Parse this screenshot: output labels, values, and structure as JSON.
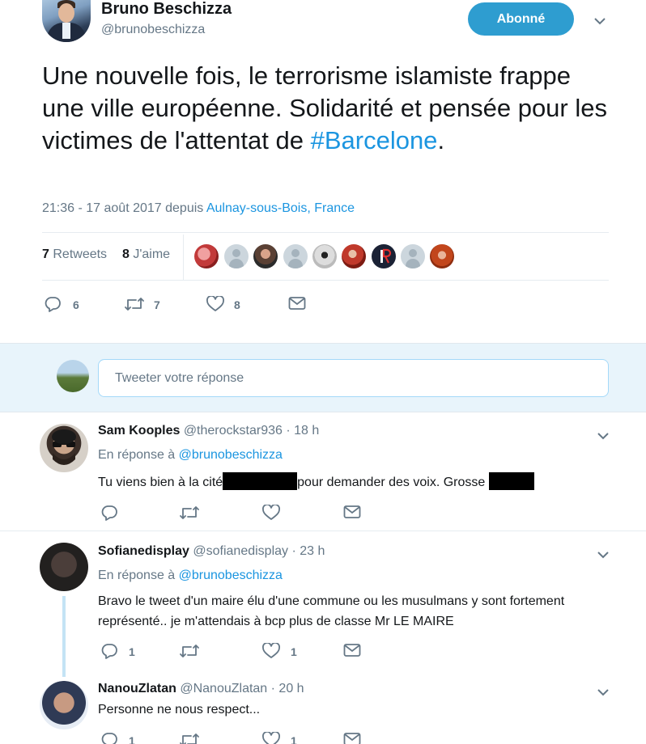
{
  "tweet": {
    "author_name": "Bruno Beschizza",
    "author_handle": "@brunobeschizza",
    "follow_label": "Abonné",
    "text_part1": "Une nouvelle fois, le terrorisme islamiste frappe une ville européenne. Solidarité et pensée pour les victimes de l'attentat de ",
    "hashtag": "#Barcelone",
    "text_part2": ".",
    "timestamp": "21:36 - 17 août 2017 depuis ",
    "location": "Aulnay-sous-Bois, France",
    "retweets_count": "7",
    "retweets_label": "Retweets",
    "likes_count": "8",
    "likes_label": "J'aime",
    "reply_count": "6",
    "retweet_count": "7",
    "like_count": "8"
  },
  "reply_box": {
    "placeholder": "Tweeter votre réponse"
  },
  "replies": [
    {
      "name": "Sam Kooples",
      "handle": "@therockstar936 · 18 h",
      "in_reply_prefix": "En réponse à ",
      "mention": "@brunobeschizza",
      "text_part1": "Tu viens bien à la cité",
      "text_part2": "pour demander des voix. Grosse",
      "reply_count": "",
      "retweet_count": "",
      "like_count": ""
    },
    {
      "name": "Sofianedisplay",
      "handle": "@sofianedisplay · 23 h",
      "in_reply_prefix": "En réponse à ",
      "mention": "@brunobeschizza",
      "text": "Bravo le tweet d'un maire élu d'une commune ou les musulmans y sont fortement représenté.. je m'attendais à bcp plus de classe Mr LE MAIRE",
      "reply_count": "1",
      "retweet_count": "",
      "like_count": "1"
    },
    {
      "name": "NanouZlatan",
      "handle": "@NanouZlatan · 20 h",
      "text": "Personne ne nous respect...",
      "reply_count": "1",
      "like_count": "1"
    }
  ],
  "colors": {
    "accent": "#1b95e0",
    "follow_button": "#2e9dd0",
    "muted_text": "#657786",
    "reply_bar_bg": "#e8f4fb"
  },
  "icons": [
    "chevron-down-icon",
    "reply-icon",
    "retweet-icon",
    "like-icon",
    "message-icon",
    "default-avatar-icon"
  ]
}
